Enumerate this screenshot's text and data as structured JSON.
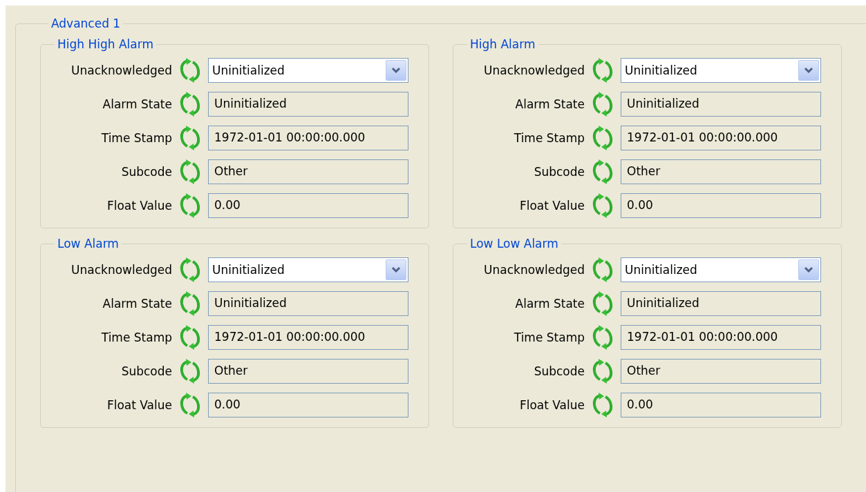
{
  "panel": {
    "title": "Advanced 1"
  },
  "groups": [
    {
      "title": "High High Alarm",
      "rows": [
        {
          "kind": "dropdown",
          "label": "Unacknowledged",
          "value": "Uninitialized"
        },
        {
          "kind": "readonly",
          "label": "Alarm State",
          "value": "Uninitialized"
        },
        {
          "kind": "readonly",
          "label": "Time Stamp",
          "value": "1972-01-01 00:00:00.000"
        },
        {
          "kind": "readonly",
          "label": "Subcode",
          "value": "Other"
        },
        {
          "kind": "readonly",
          "label": "Float Value",
          "value": "0.00"
        }
      ]
    },
    {
      "title": "High Alarm",
      "rows": [
        {
          "kind": "dropdown",
          "label": "Unacknowledged",
          "value": "Uninitialized"
        },
        {
          "kind": "readonly",
          "label": "Alarm State",
          "value": "Uninitialized"
        },
        {
          "kind": "readonly",
          "label": "Time Stamp",
          "value": "1972-01-01 00:00:00.000"
        },
        {
          "kind": "readonly",
          "label": "Subcode",
          "value": "Other"
        },
        {
          "kind": "readonly",
          "label": "Float Value",
          "value": "0.00"
        }
      ]
    },
    {
      "title": "Low Alarm",
      "rows": [
        {
          "kind": "dropdown",
          "label": "Unacknowledged",
          "value": "Uninitialized"
        },
        {
          "kind": "readonly",
          "label": "Alarm State",
          "value": "Uninitialized"
        },
        {
          "kind": "readonly",
          "label": "Time Stamp",
          "value": "1972-01-01 00:00:00.000"
        },
        {
          "kind": "readonly",
          "label": "Subcode",
          "value": "Other"
        },
        {
          "kind": "readonly",
          "label": "Float Value",
          "value": "0.00"
        }
      ]
    },
    {
      "title": "Low Low Alarm",
      "rows": [
        {
          "kind": "dropdown",
          "label": "Unacknowledged",
          "value": "Uninitialized"
        },
        {
          "kind": "readonly",
          "label": "Alarm State",
          "value": "Uninitialized"
        },
        {
          "kind": "readonly",
          "label": "Time Stamp",
          "value": "1972-01-01 00:00:00.000"
        },
        {
          "kind": "readonly",
          "label": "Subcode",
          "value": "Other"
        },
        {
          "kind": "readonly",
          "label": "Float Value",
          "value": "0.00"
        }
      ]
    }
  ]
}
